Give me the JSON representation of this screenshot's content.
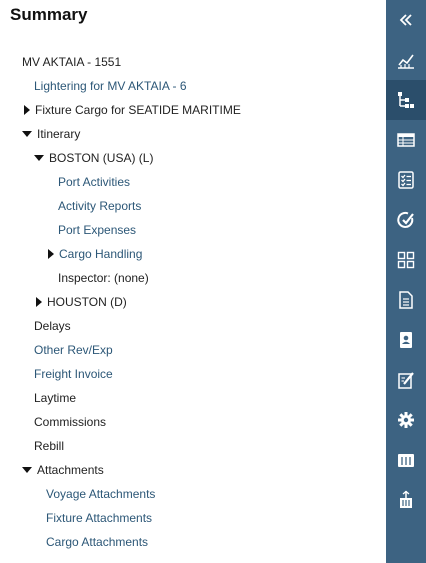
{
  "title": "Summary",
  "tree": {
    "vessel": "MV AKTAIA - 1551",
    "lightering": "Lightering for MV AKTAIA - 6",
    "fixture_cargo": "Fixture Cargo for SEATIDE MARITIME",
    "itinerary": "Itinerary",
    "boston": "BOSTON (USA) (L)",
    "port_activities": "Port Activities",
    "activity_reports": "Activity Reports",
    "port_expenses": "Port Expenses",
    "cargo_handling": "Cargo Handling",
    "inspector": "Inspector: (none)",
    "houston": "HOUSTON (D)",
    "delays": "Delays",
    "other_rev_exp": "Other Rev/Exp",
    "freight_invoice": "Freight Invoice",
    "laytime": "Laytime",
    "commissions": "Commissions",
    "rebill": "Rebill",
    "attachments": "Attachments",
    "voyage_attachments": "Voyage Attachments",
    "fixture_attachments": "Fixture Attachments",
    "cargo_attachments": "Cargo Attachments"
  },
  "colors": {
    "sidebar_bg": "#3d6382",
    "sidebar_active": "#2b4e6b",
    "link": "#2c5777"
  },
  "sidebar_icons": [
    "collapse-double-chevron-icon",
    "chart-icon",
    "hierarchy-tree-icon",
    "table-grid-icon",
    "checklist-icon",
    "target-check-icon",
    "layout-tiles-icon",
    "document-icon",
    "contact-card-icon",
    "edit-note-icon",
    "settings-gear-icon",
    "container-icon",
    "ship-crane-icon"
  ]
}
